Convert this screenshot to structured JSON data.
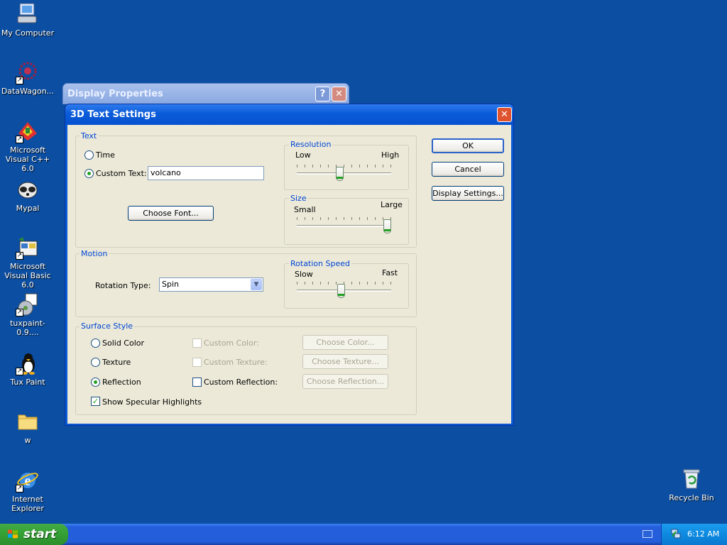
{
  "desktop": {
    "icons": [
      {
        "label": "My Computer",
        "icon": "computer-icon"
      },
      {
        "label": "DataWagon...",
        "icon": "datawagon-icon"
      },
      {
        "label": "Microsoft Visual C++ 6.0",
        "icon": "visual-cpp-icon"
      },
      {
        "label": "Mypal",
        "icon": "mypal-icon"
      },
      {
        "label": "Microsoft Visual Basic 6.0",
        "icon": "visual-basic-icon"
      },
      {
        "label": "tuxpaint-0.9....",
        "icon": "tuxpaint-installer-icon"
      },
      {
        "label": "Tux Paint",
        "icon": "tuxpaint-icon"
      },
      {
        "label": "w",
        "icon": "folder-icon"
      },
      {
        "label": "Internet Explorer",
        "icon": "internet-explorer-icon"
      },
      {
        "label": "Recycle Bin",
        "icon": "recycle-bin-icon"
      }
    ]
  },
  "background_window": {
    "title": "Display Properties",
    "help_glyph": "?",
    "close_glyph": "✕"
  },
  "dialog": {
    "title": "3D Text Settings",
    "close_glyph": "✕",
    "text_group": {
      "title": "Text",
      "time_label": "Time",
      "custom_text_label": "Custom Text:",
      "custom_text_value": "volcano",
      "selected": "custom_text",
      "choose_font_label": "Choose Font..."
    },
    "resolution": {
      "title": "Resolution",
      "low": "Low",
      "high": "High",
      "level": 0.45
    },
    "size": {
      "title": "Size",
      "small": "Small",
      "large": "Large",
      "level": 1.0
    },
    "motion_group": {
      "title": "Motion",
      "rotation_type_label": "Rotation Type:",
      "rotation_type_value": "Spin"
    },
    "rotation_speed": {
      "title": "Rotation Speed",
      "slow": "Slow",
      "fast": "Fast",
      "level": 0.47
    },
    "surface_group": {
      "title": "Surface Style",
      "solid_color_label": "Solid Color",
      "texture_label": "Texture",
      "reflection_label": "Reflection",
      "selected": "reflection",
      "custom_color_label": "Custom Color:",
      "custom_texture_label": "Custom Texture:",
      "custom_reflection_label": "Custom Reflection:",
      "choose_color_label": "Choose Color...",
      "choose_texture_label": "Choose Texture...",
      "choose_reflection_label": "Choose Reflection...",
      "show_specular_label": "Show Specular Highlights",
      "show_specular_checked": true
    },
    "buttons": {
      "ok": "OK",
      "cancel": "Cancel",
      "display_settings": "Display Settings..."
    }
  },
  "taskbar": {
    "start_label": "start",
    "clock": "6:12 AM"
  },
  "colors": {
    "desktop": "#0b4ea2",
    "dialog_title": "#0a5ad4",
    "group_title": "#0046d5",
    "start_button": "#36a336"
  }
}
